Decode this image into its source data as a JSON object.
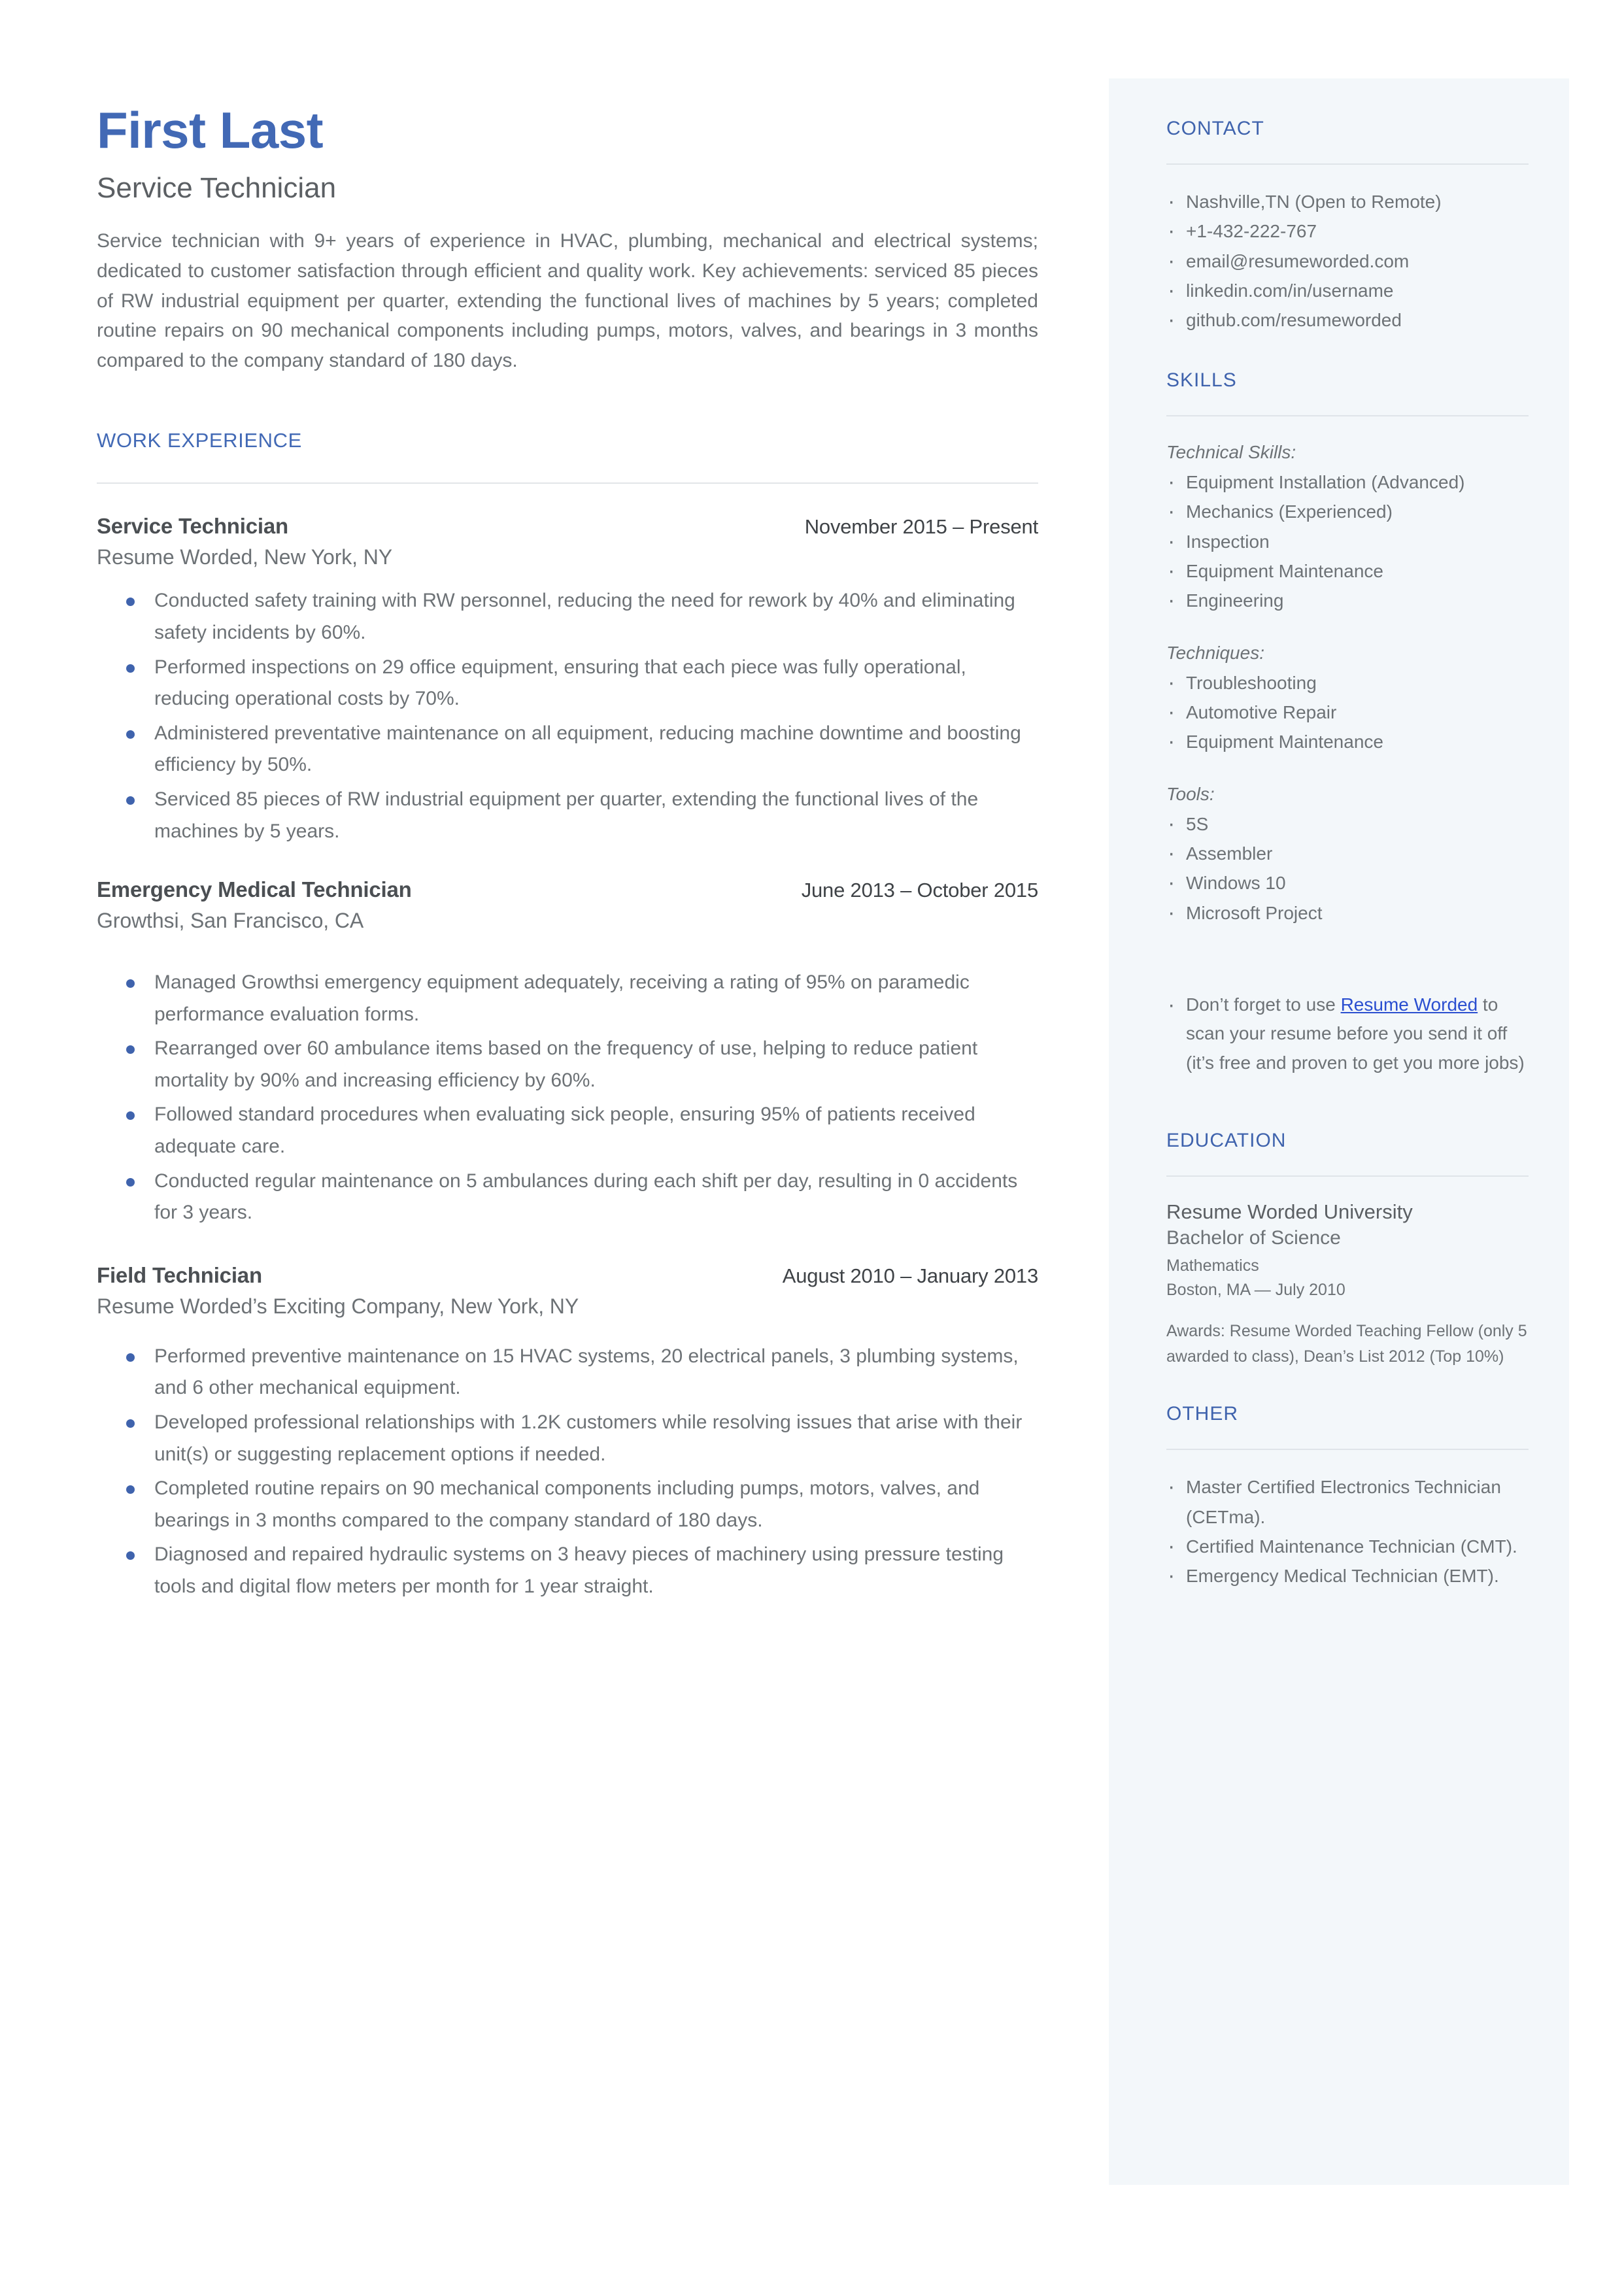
{
  "header": {
    "name": "First Last",
    "job_title": "Service Technician",
    "summary": "Service technician with 9+ years of experience in HVAC, plumbing, mechanical and electrical systems; dedicated to customer satisfaction through efficient and quality work. Key achievements: serviced 85 pieces of RW industrial equipment per quarter, extending the functional lives of machines by 5 years; completed routine repairs on 90 mechanical components including pumps, motors, valves, and bearings in 3 months compared to the company standard of 180 days."
  },
  "work_experience": {
    "heading": "WORK EXPERIENCE",
    "jobs": [
      {
        "role": "Service Technician",
        "dates": "November 2015 – Present",
        "company": "Resume Worded, New York, NY",
        "bullets": [
          "Conducted safety training with RW personnel, reducing the need for rework by 40% and eliminating safety incidents by 60%.",
          "Performed inspections on 29 office equipment, ensuring that each piece was fully operational, reducing operational costs by 70%.",
          "Administered preventative maintenance on all equipment, reducing machine downtime and boosting efficiency by 50%.",
          "Serviced 85 pieces of RW industrial equipment per quarter, extending the functional lives of the machines by 5 years."
        ]
      },
      {
        "role": "Emergency Medical Technician",
        "dates": "June 2013 – October 2015",
        "company": "Growthsi, San Francisco, CA",
        "bullets": [
          "Managed Growthsi emergency equipment adequately, receiving a rating of 95% on paramedic performance evaluation forms.",
          "Rearranged over 60 ambulance items based on the frequency of use, helping to reduce patient mortality by 90% and increasing efficiency by 60%.",
          "Followed standard procedures when evaluating sick people, ensuring 95% of patients received adequate care.",
          "Conducted regular maintenance on 5  ambulances during each shift per day, resulting in 0 accidents for 3 years."
        ]
      },
      {
        "role": "Field Technician",
        "dates": "August 2010 – January 2013",
        "company": "Resume Worded’s Exciting Company, New York, NY",
        "bullets": [
          "Performed preventive maintenance on 15 HVAC systems, 20 electrical panels, 3 plumbing systems, and 6 other mechanical equipment.",
          "Developed professional relationships with 1.2K customers while resolving issues that arise with their unit(s) or suggesting replacement options if needed.",
          "Completed routine repairs on 90 mechanical components including pumps, motors, valves, and bearings in 3 months compared to the company standard of 180 days.",
          "Diagnosed and repaired hydraulic systems on 3 heavy pieces of machinery using pressure testing tools and digital flow meters per month for 1 year straight."
        ]
      }
    ]
  },
  "sidebar": {
    "contact": {
      "heading": "CONTACT",
      "items": [
        "Nashville,TN (Open to Remote)",
        "+1-432-222-767",
        "email@resumeworded.com",
        "linkedin.com/in/username",
        "github.com/resumeworded"
      ]
    },
    "skills": {
      "heading": "SKILLS",
      "groups": [
        {
          "label": "Technical Skills:",
          "items": [
            "Equipment Installation (Advanced)",
            "Mechanics (Experienced)",
            "Inspection",
            "Equipment Maintenance",
            "Engineering"
          ]
        },
        {
          "label": "Techniques:",
          "items": [
            "Troubleshooting",
            "Automotive Repair",
            "Equipment Maintenance"
          ]
        },
        {
          "label": "Tools:",
          "items": [
            "5S",
            "Assembler",
            "Windows 10",
            "Microsoft Project"
          ]
        }
      ]
    },
    "promo": {
      "prefix": "Don’t forget to use ",
      "link_text": "Resume Worded",
      "suffix": " to scan your resume before you send it off (it’s free and proven to get you more jobs)"
    },
    "education": {
      "heading": "EDUCATION",
      "school": "Resume Worded University",
      "degree": "Bachelor of Science",
      "field": "Mathematics",
      "place": "Boston, MA — July 2010",
      "awards": "Awards: Resume Worded Teaching Fellow (only 5 awarded to class), Dean’s List 2012 (Top 10%)"
    },
    "other": {
      "heading": "OTHER",
      "items": [
        "Master Certified Electronics Technician (CETma).",
        "Certified Maintenance Technician (CMT).",
        "Emergency Medical Technician (EMT)."
      ]
    }
  },
  "colors": {
    "accent_blue": "#4269b5",
    "heading_blue": "#3f63ad",
    "body_gray": "#6d7276",
    "sidebar_bg": "#f3f7fa",
    "link_blue": "#2b4fd0",
    "rule_gray": "#e2e5e8"
  }
}
